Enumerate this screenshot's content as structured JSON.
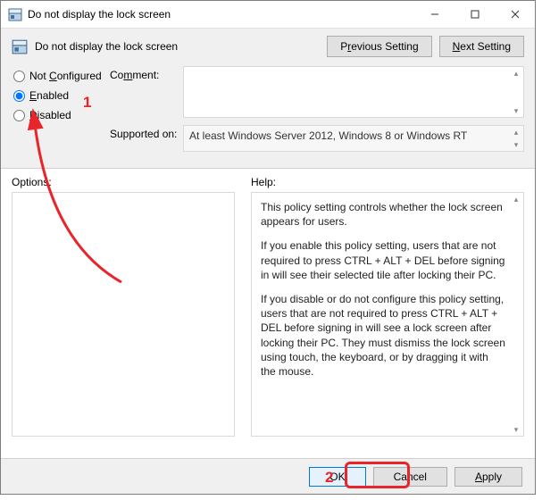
{
  "window": {
    "title": "Do not display the lock screen",
    "minimize": "–",
    "maximize": "□",
    "close": "×"
  },
  "header": {
    "policy_title": "Do not display the lock screen",
    "prev_btn_pre": "P",
    "prev_btn_u": "r",
    "prev_btn_post": "evious Setting",
    "next_btn_u": "N",
    "next_btn_post": "ext Setting"
  },
  "state": {
    "not_configured_u": "C",
    "not_configured_post": "onfigured",
    "not_configured_pre": "Not ",
    "enabled_u": "E",
    "enabled_post": "nabled",
    "disabled_u": "D",
    "disabled_post": "isabled",
    "selected": "enabled"
  },
  "fields": {
    "comment_pre": "Co",
    "comment_u": "m",
    "comment_post": "ment:",
    "supported_label": "Supported on:",
    "supported_text": "At least Windows Server 2012, Windows 8 or Windows RT"
  },
  "middle": {
    "options_label": "Options:",
    "help_label": "Help:"
  },
  "help": {
    "p1": "This policy setting controls whether the lock screen appears for users.",
    "p2": "If you enable this policy setting, users that are not required to press CTRL + ALT + DEL before signing in will see their selected tile after locking their PC.",
    "p3": "If you disable or do not configure this policy setting, users that are not required to press CTRL + ALT + DEL before signing in will see a lock screen after locking their PC. They must dismiss the lock screen using touch, the keyboard, or by dragging it with the mouse."
  },
  "buttons": {
    "ok": "OK",
    "cancel": "Cancel",
    "apply_u": "A",
    "apply_post": "pply"
  },
  "annotations": {
    "num1": "1",
    "num2": "2"
  }
}
